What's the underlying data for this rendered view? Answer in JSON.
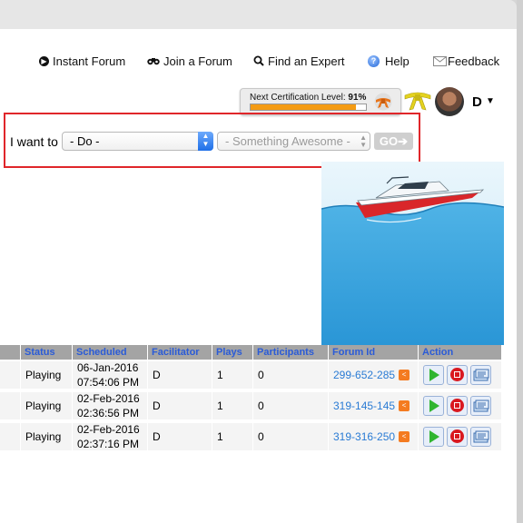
{
  "nav": {
    "instant_forum": "Instant Forum",
    "join_forum": "Join a Forum",
    "find_expert": "Find an Expert",
    "help": "Help",
    "feedback": "Feedback"
  },
  "cert": {
    "label": "Next Certification Level:",
    "percent_text": "91%",
    "progress": 0.91
  },
  "user": {
    "initial": "D",
    "caret": "▼"
  },
  "iwant": {
    "label": "I want to",
    "do_value": "- Do -",
    "something_value": "- Something Awesome -",
    "go_label": "GO"
  },
  "table": {
    "headers": [
      "Status",
      "Scheduled",
      "Facilitator",
      "Plays",
      "Participants",
      "Forum Id",
      "Action"
    ],
    "rows": [
      {
        "status": "Playing",
        "date": "06-Jan-2016",
        "time": "07:54:06 PM",
        "facilitator": "D",
        "plays": "1",
        "participants": "0",
        "forum_id": "299-652-285"
      },
      {
        "status": "Playing",
        "date": "02-Feb-2016",
        "time": "02:36:56 PM",
        "facilitator": "D",
        "plays": "1",
        "participants": "0",
        "forum_id": "319-145-145"
      },
      {
        "status": "Playing",
        "date": "02-Feb-2016",
        "time": "02:37:16 PM",
        "facilitator": "D",
        "plays": "1",
        "participants": "0",
        "forum_id": "319-316-250"
      }
    ]
  },
  "icons": {
    "instant_forum": "circle-arrow-icon",
    "join_forum": "binoculars-icon",
    "find_expert": "search-icon",
    "help": "help-icon",
    "feedback": "envelope-icon",
    "share": "share-icon",
    "play": "play-icon",
    "stop": "stop-icon",
    "edit": "edit-forum-icon"
  },
  "colors": {
    "link": "#2a7bd4",
    "header_text": "#2a5bd7",
    "highlight_border": "#e0262a",
    "progress_fill": "#f49b13",
    "share": "#f47b20",
    "play": "#2fb52f",
    "stop": "#d9181f"
  }
}
